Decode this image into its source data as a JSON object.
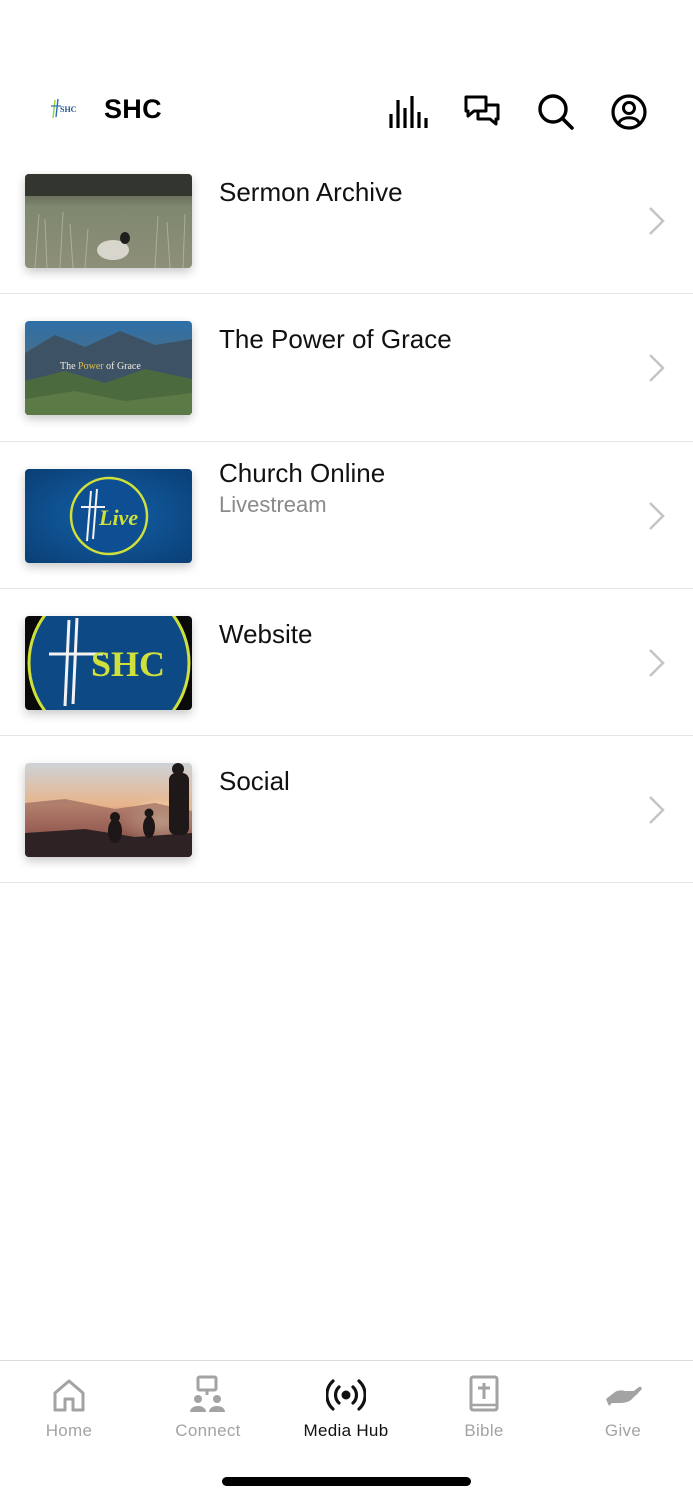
{
  "header": {
    "logo_text": "SHC",
    "title": "SHC",
    "icons": [
      "audio-bars-icon",
      "chat-icon",
      "search-icon",
      "profile-icon"
    ]
  },
  "items": [
    {
      "title": "Sermon Archive",
      "subtitle": "",
      "thumb": "field-with-sheep"
    },
    {
      "title": "The Power of Grace",
      "subtitle": "",
      "thumb": "mountain-landscape",
      "thumb_text": {
        "prefix": "The ",
        "accent": "Power",
        "suffix": " of Grace"
      }
    },
    {
      "title": "Church Online",
      "subtitle": "Livestream",
      "thumb": "live-badge",
      "thumb_text": "Live"
    },
    {
      "title": "Website",
      "subtitle": "",
      "thumb": "shc-badge",
      "thumb_text": "SHC"
    },
    {
      "title": "Social",
      "subtitle": "",
      "thumb": "sunset-hikers"
    }
  ],
  "tabs": [
    {
      "label": "Home",
      "icon": "home-icon",
      "active": false
    },
    {
      "label": "Connect",
      "icon": "connect-icon",
      "active": false
    },
    {
      "label": "Media Hub",
      "icon": "broadcast-icon",
      "active": true
    },
    {
      "label": "Bible",
      "icon": "bible-icon",
      "active": false
    },
    {
      "label": "Give",
      "icon": "give-hand-icon",
      "active": false
    }
  ],
  "colors": {
    "brand_blue": "#0d4a85",
    "brand_lime": "#cfe03a",
    "inactive_tab": "#a3a3a3",
    "divider": "#e6e6e6"
  }
}
